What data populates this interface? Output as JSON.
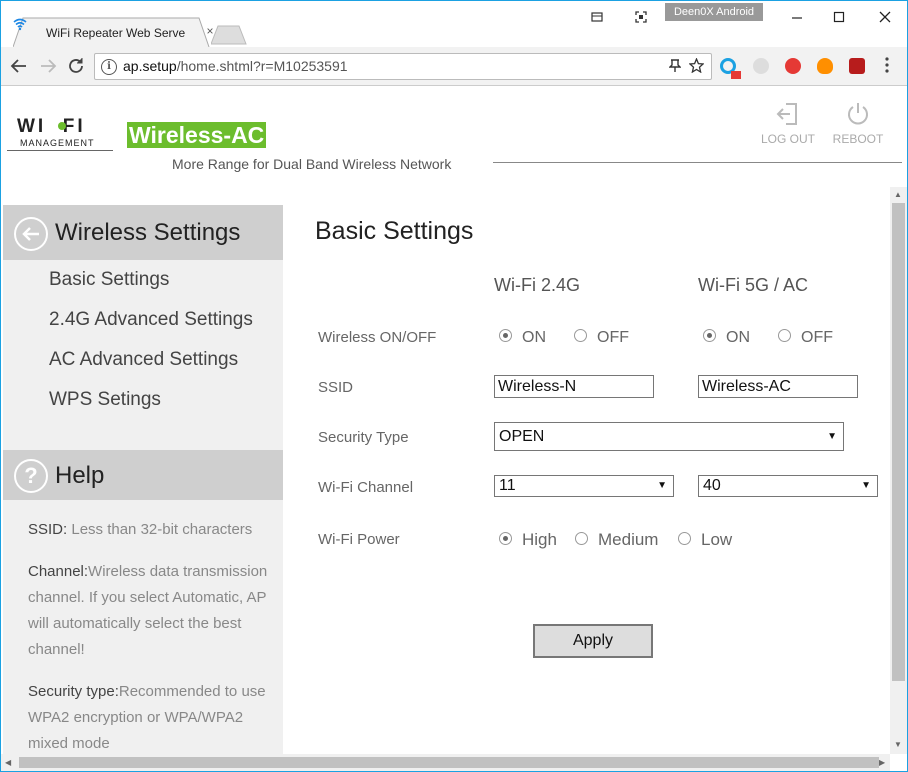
{
  "browser": {
    "tab_title": "WiFi Repeater Web Serve",
    "profile_name": "Deen0X Android",
    "url_host": "ap.setup",
    "url_path": "/home.shtml?r=M10253591",
    "tab_close_glyph": "×"
  },
  "header": {
    "logo_text": "WI  FI",
    "logo_sub": "MANAGEMENT",
    "brand": "Wireless-AC",
    "tagline": "More Range for Dual Band Wireless Network",
    "logout_label": "LOG OUT",
    "reboot_label": "REBOOT",
    "accent_color": "#6cbd2d"
  },
  "sidebar": {
    "section_title": "Wireless Settings",
    "items": [
      {
        "label": "Basic Settings"
      },
      {
        "label": "2.4G Advanced Settings"
      },
      {
        "label": "AC Advanced Settings"
      },
      {
        "label": "WPS Setings"
      }
    ],
    "help_title": "Help",
    "help_icon": "?",
    "help": [
      {
        "key": "SSID:",
        "text": " Less than 32-bit characters"
      },
      {
        "key": "Channel:",
        "text": "Wireless data transmission channel. If you select Automatic, AP will automatically select the best channel!"
      },
      {
        "key": "Security type:",
        "text": "Recommended to use WPA2 encryption or WPA/WPA2 mixed mode"
      }
    ]
  },
  "main": {
    "title": "Basic Settings",
    "col_24": "Wi-Fi 2.4G",
    "col_5": "Wi-Fi 5G / AC",
    "labels": {
      "wireless": "Wireless ON/OFF",
      "ssid": "SSID",
      "security": "Security Type",
      "channel": "Wi-Fi Channel",
      "power": "Wi-Fi Power"
    },
    "on_label": "ON",
    "off_label": "OFF",
    "wireless_24_state": "ON",
    "wireless_5_state": "ON",
    "ssid_24": "Wireless-N",
    "ssid_5": "Wireless-AC",
    "security_type": "OPEN",
    "channel_24": "11",
    "channel_5": "40",
    "power_options": [
      "High",
      "Medium",
      "Low"
    ],
    "power_selected": "High",
    "apply_label": "Apply"
  }
}
